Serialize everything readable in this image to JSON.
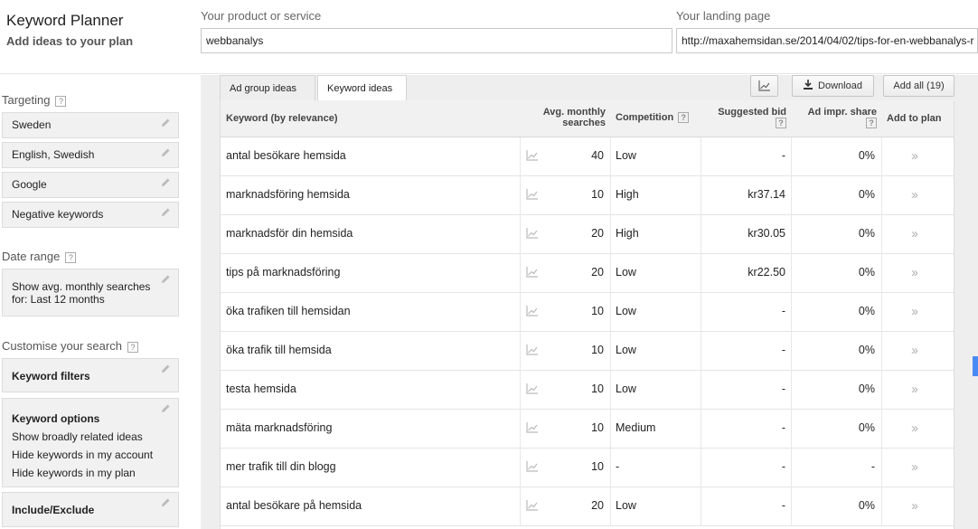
{
  "header": {
    "title": "Keyword Planner",
    "subtitle": "Add ideas to your plan",
    "product_label": "Your product or service",
    "product_value": "webbanalys",
    "landing_label": "Your landing page",
    "landing_value": "http://maxahemsidan.se/2014/04/02/tips-for-en-webbanalys-r"
  },
  "sidebar": {
    "targeting_title": "Targeting",
    "targeting_items": [
      "Sweden",
      "English, Swedish",
      "Google",
      "Negative keywords"
    ],
    "date_title": "Date range",
    "date_text": "Show avg. monthly searches for: Last 12 months",
    "customise_title": "Customise your search",
    "keyword_filters": "Keyword filters",
    "keyword_options": {
      "title": "Keyword options",
      "lines": [
        "Show broadly related ideas",
        "Hide keywords in my account",
        "Hide keywords in my plan"
      ]
    },
    "include_exclude": "Include/Exclude",
    "help_glyph": "?"
  },
  "tabs": [
    "Ad group ideas",
    "Keyword ideas"
  ],
  "toolbar": {
    "download": "Download",
    "add_all": "Add all (19)"
  },
  "table": {
    "headers": {
      "keyword": "Keyword (by relevance)",
      "searches_1": "Avg. monthly",
      "searches_2": "searches",
      "competition": "Competition",
      "bid": "Suggested bid",
      "impr": "Ad impr. share",
      "add": "Add to plan"
    },
    "rows": [
      {
        "keyword": "antal besökare hemsida",
        "searches": "40",
        "competition": "Low",
        "bid": "-",
        "impr": "0%"
      },
      {
        "keyword": "marknadsföring hemsida",
        "searches": "10",
        "competition": "High",
        "bid": "kr37.14",
        "impr": "0%"
      },
      {
        "keyword": "marknadsför din hemsida",
        "searches": "20",
        "competition": "High",
        "bid": "kr30.05",
        "impr": "0%"
      },
      {
        "keyword": "tips på marknadsföring",
        "searches": "20",
        "competition": "Low",
        "bid": "kr22.50",
        "impr": "0%"
      },
      {
        "keyword": "öka trafiken till hemsidan",
        "searches": "10",
        "competition": "Low",
        "bid": "-",
        "impr": "0%"
      },
      {
        "keyword": "öka trafik till hemsida",
        "searches": "10",
        "competition": "Low",
        "bid": "-",
        "impr": "0%"
      },
      {
        "keyword": "testa hemsida",
        "searches": "10",
        "competition": "Low",
        "bid": "-",
        "impr": "0%"
      },
      {
        "keyword": "mäta marknadsföring",
        "searches": "10",
        "competition": "Medium",
        "bid": "-",
        "impr": "0%"
      },
      {
        "keyword": "mer trafik till din blogg",
        "searches": "10",
        "competition": "-",
        "bid": "-",
        "impr": "-"
      },
      {
        "keyword": "antal besökare på hemsida",
        "searches": "20",
        "competition": "Low",
        "bid": "-",
        "impr": "0%"
      }
    ]
  },
  "colors": {
    "accent": "#4a8af4",
    "panel": "#f1f1f1",
    "border": "#dcdcdc"
  },
  "icons": {
    "edit": "pencil-icon",
    "trend": "trend-chart-icon",
    "download": "download-icon",
    "add": "chevron-right-double-icon"
  }
}
